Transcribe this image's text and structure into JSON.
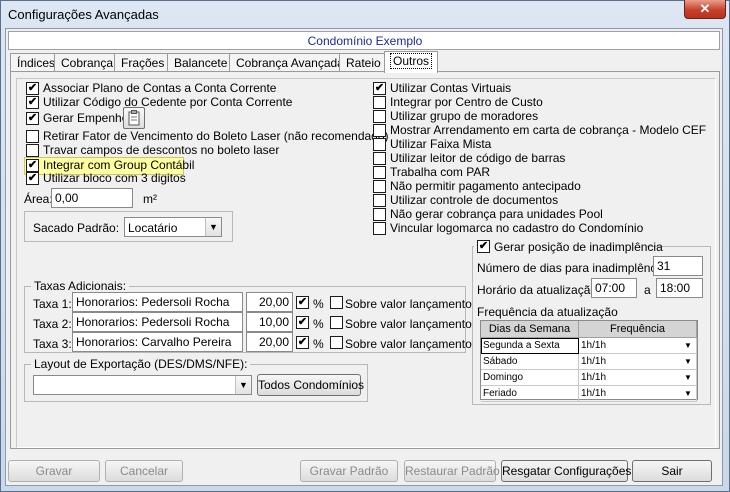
{
  "window": {
    "title": "Configurações Avançadas",
    "close_glyph": "✕"
  },
  "condominio": "Condomínio Exemplo",
  "tabs": [
    "Índices",
    "Cobrança",
    "Frações",
    "Balancete",
    "Cobrança Avançada",
    "Rateio",
    "Outros"
  ],
  "left_options": [
    {
      "label": "Associar Plano de Contas a Conta Corrente",
      "checked": true
    },
    {
      "label": "Utilizar Código do Cedente por Conta Corrente",
      "checked": true
    },
    {
      "label": "Gerar Empenho",
      "checked": true
    },
    {
      "label": "Retirar Fator de Vencimento do Boleto Laser (não recomendado)",
      "checked": false
    },
    {
      "label": "Travar campos de descontos no boleto laser",
      "checked": false
    },
    {
      "label": "Integrar com Group Contábil",
      "checked": true
    },
    {
      "label": "Utilizar bloco com 3 digitos",
      "checked": true
    }
  ],
  "area": {
    "label": "Área:",
    "value": "0,00",
    "unit": "m²"
  },
  "sacado": {
    "label": "Sacado Padrão:",
    "value": "Locatário"
  },
  "right_options": [
    {
      "label": "Utilizar Contas Virtuais",
      "checked": true
    },
    {
      "label": "Integrar por Centro de Custo",
      "checked": false
    },
    {
      "label": "Utilizar grupo de moradores",
      "checked": false
    },
    {
      "label": "Mostrar Arrendamento em carta de cobrança - Modelo CEF",
      "checked": false
    },
    {
      "label": "Utilizar Faixa Mista",
      "checked": false
    },
    {
      "label": "Utilizar leitor de código de barras",
      "checked": false
    },
    {
      "label": "Trabalha com PAR",
      "checked": false
    },
    {
      "label": "Não permitir pagamento antecipado",
      "checked": false
    },
    {
      "label": "Utilizar controle de documentos",
      "checked": false
    },
    {
      "label": "Não gerar cobrança para unidades Pool",
      "checked": false
    },
    {
      "label": "Vincular logomarca no cadastro do Condomínio",
      "checked": false
    }
  ],
  "inadimplencia": {
    "title": "Gerar posição de inadimplência",
    "checked": true,
    "dias_label": "Número de dias para inadimplência",
    "dias_value": "31",
    "horario_label": "Horário da atualização",
    "horario_from": "07:00",
    "horario_sep": "a",
    "horario_to": "18:00",
    "freq_label": "Frequência da atualização",
    "grid_headers": [
      "Dias da Semana",
      "Frequência"
    ],
    "grid_rows": [
      {
        "dia": "Segunda a Sexta",
        "freq": "1h/1h"
      },
      {
        "dia": "Sábado",
        "freq": "1h/1h"
      },
      {
        "dia": "Domingo",
        "freq": "1h/1h"
      },
      {
        "dia": "Feriado",
        "freq": "1h/1h"
      }
    ]
  },
  "taxas": {
    "title": "Taxas Adicionais:",
    "rows": [
      {
        "label": "Taxa 1:",
        "desc": "Honorarios: Pedersoli Rocha",
        "value": "20,00",
        "pct_checked": true,
        "pct": "%",
        "sobre_checked": false,
        "sobre": "Sobre valor lançamento"
      },
      {
        "label": "Taxa 2:",
        "desc": "Honorarios: Pedersoli Rocha",
        "value": "10,00",
        "pct_checked": true,
        "pct": "%",
        "sobre_checked": false,
        "sobre": "Sobre valor lançamento"
      },
      {
        "label": "Taxa 3:",
        "desc": "Honorarios: Carvalho Pereira",
        "value": "20,00",
        "pct_checked": true,
        "pct": "%",
        "sobre_checked": false,
        "sobre": "Sobre valor lançamento"
      }
    ]
  },
  "layout_export": {
    "title": "Layout de Exportação (DES/DMS/NFE):",
    "value": "",
    "button": "Todos Condomínios"
  },
  "buttons": {
    "gravar": "Gravar",
    "cancelar": "Cancelar",
    "gravar_padrao": "Gravar Padrão",
    "restaurar_padrao": "Restaurar Padrão",
    "resgatar": "Resgatar Configurações",
    "sair": "Sair"
  }
}
